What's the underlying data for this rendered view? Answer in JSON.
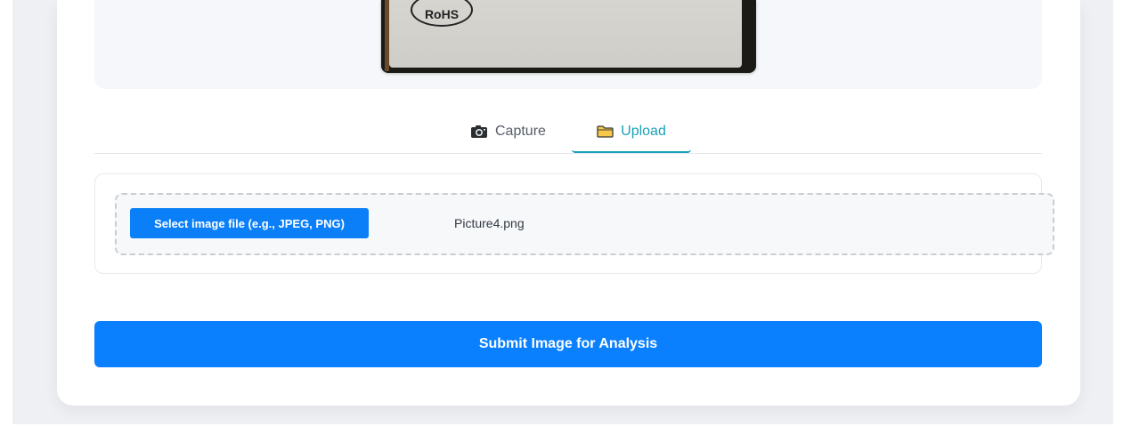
{
  "preview": {
    "photo_marking": "RoHS"
  },
  "tabs": [
    {
      "label": "Capture",
      "icon": "camera-icon",
      "active": false
    },
    {
      "label": "Upload",
      "icon": "folder-icon",
      "active": true
    }
  ],
  "upload": {
    "select_button_label": "Select image file (e.g., JPEG, PNG)",
    "selected_file_name": "Picture4.png"
  },
  "actions": {
    "submit_label": "Submit Image for Analysis"
  },
  "colors": {
    "accent_tab": "#17a2b8",
    "primary_button": "#0a80ff"
  }
}
